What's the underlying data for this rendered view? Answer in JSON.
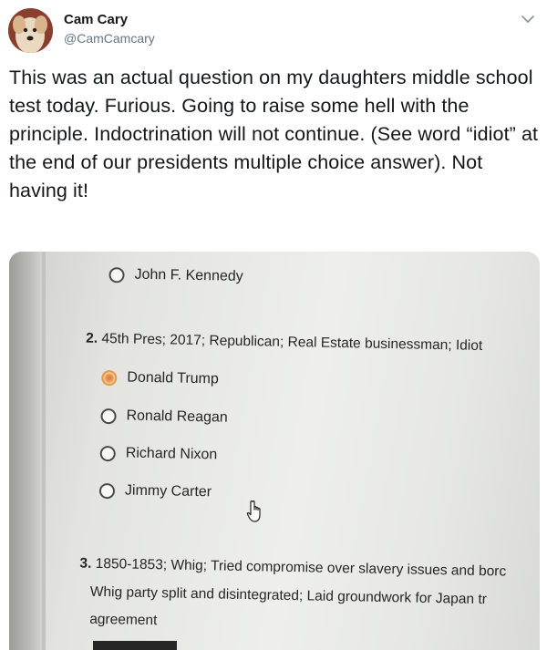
{
  "author": {
    "name": "Cam Cary",
    "handle": "@CamCamcary"
  },
  "tweet": {
    "text": "This was an actual question on my daughters middle school test today. Furious. Going to raise some hell with the principle. Indoctrination will not continue. (See word “idiot” at the end of our presidents multiple choice answer). Not having it!"
  },
  "icons": {
    "caret": "chevron-down-icon",
    "cursor": "hand-pointer-icon"
  },
  "colors": {
    "text": "#14171a",
    "handle": "#657786",
    "selected_radio": "#e8964f"
  },
  "photo": {
    "prev_option": "John F. Kennedy",
    "question2": {
      "number": "2.",
      "text": "45th Pres; 2017; Republican; Real Estate businessman; Idiot",
      "options": [
        {
          "label": "Donald Trump",
          "selected": true
        },
        {
          "label": "Ronald Reagan",
          "selected": false
        },
        {
          "label": "Richard Nixon",
          "selected": false
        },
        {
          "label": "Jimmy Carter",
          "selected": false
        }
      ]
    },
    "question3": {
      "number": "3.",
      "line1": "1850-1853; Whig; Tried compromise over slavery issues and borc",
      "line2": "Whig party split and disintegrated; Laid groundwork for Japan tr",
      "line3": "agreement"
    }
  }
}
